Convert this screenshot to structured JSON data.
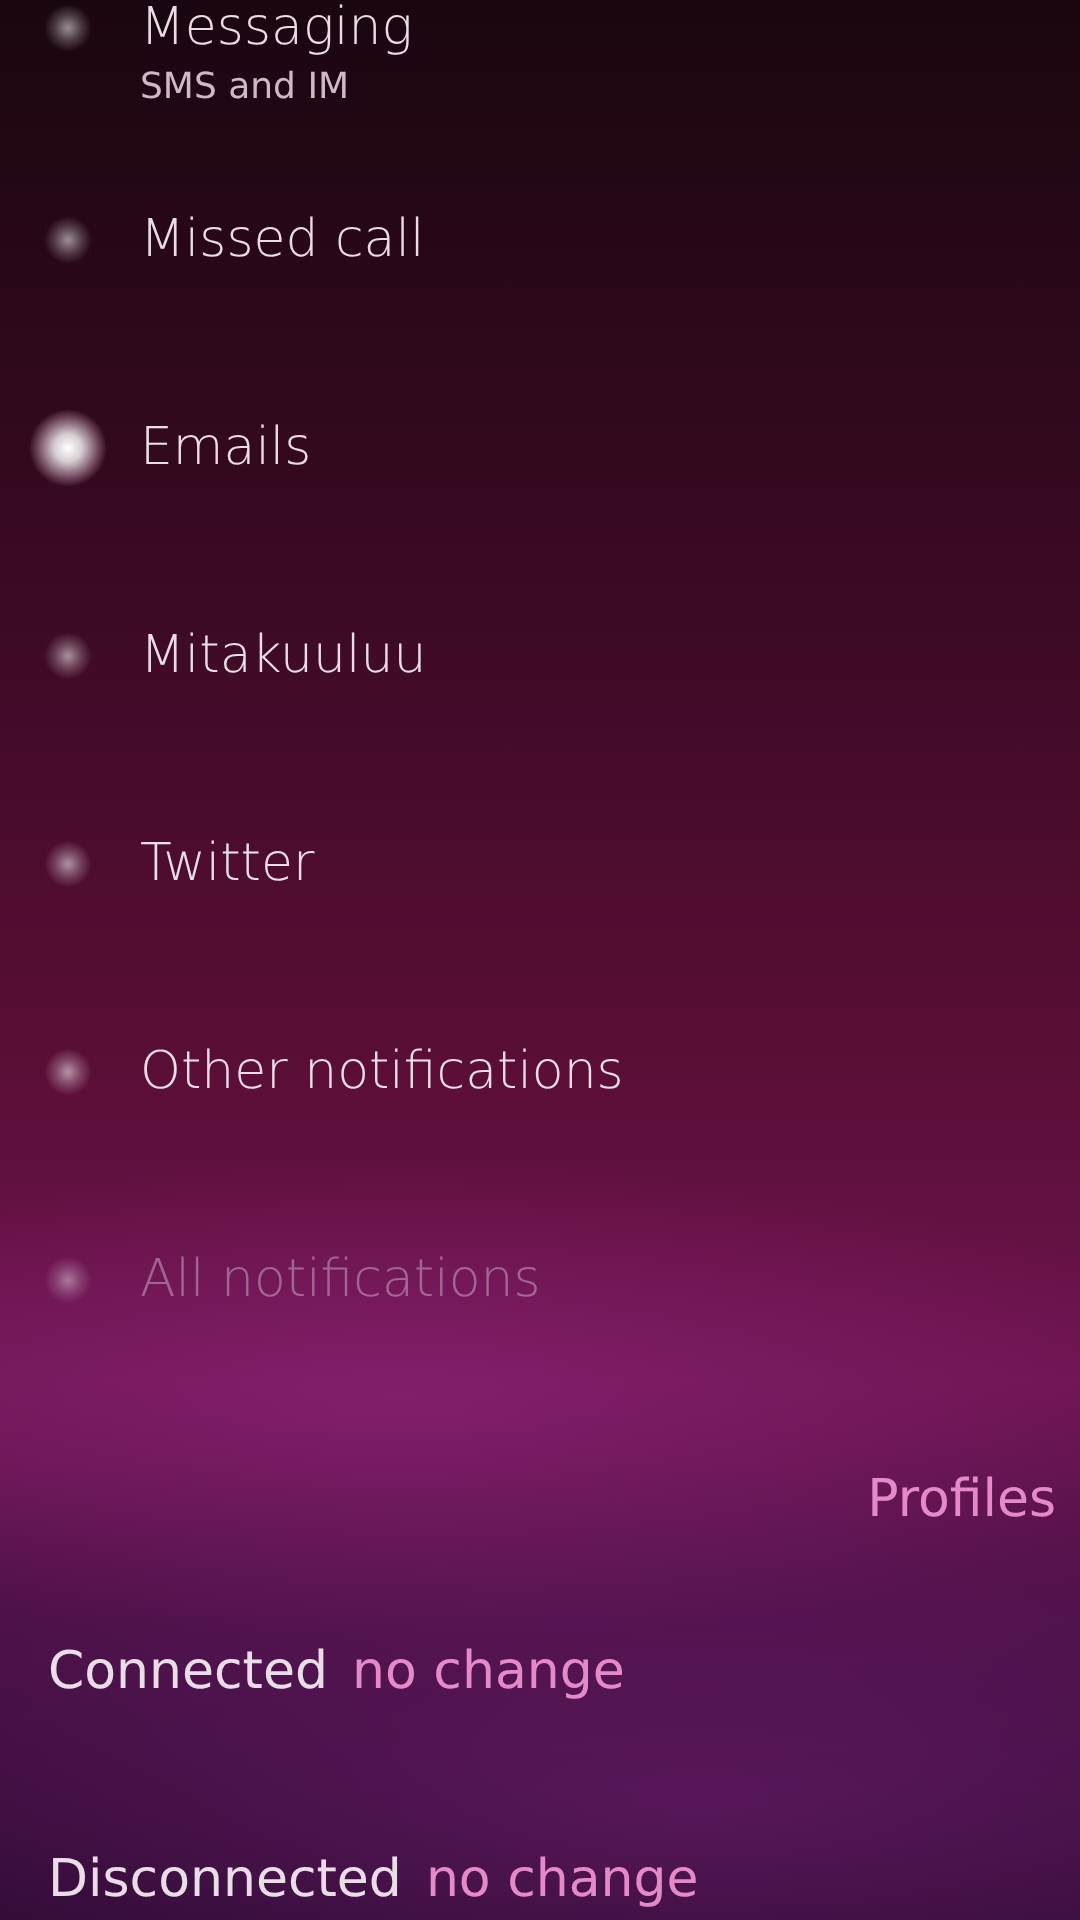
{
  "switches": [
    {
      "label": "Messaging",
      "description": "SMS and IM",
      "checked": false,
      "disabled": false
    },
    {
      "label": "Missed call",
      "checked": false,
      "disabled": false
    },
    {
      "label": "Emails",
      "checked": true,
      "disabled": false
    },
    {
      "label": "Mitakuuluu",
      "checked": false,
      "disabled": false
    },
    {
      "label": "Twitter",
      "checked": false,
      "disabled": false
    },
    {
      "label": "Other notifications",
      "checked": false,
      "disabled": false
    },
    {
      "label": "All notifications",
      "checked": false,
      "disabled": true
    }
  ],
  "section_header": "Profiles",
  "profiles": [
    {
      "label": "Connected",
      "value": "no change"
    },
    {
      "label": "Disconnected",
      "value": "no change"
    }
  ]
}
